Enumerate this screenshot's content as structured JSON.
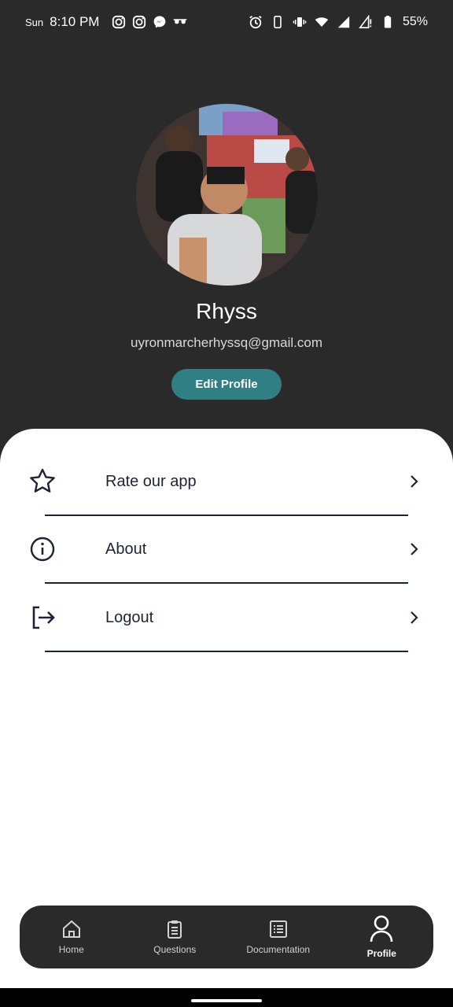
{
  "status_bar": {
    "day": "Sun",
    "time": "8:10 PM",
    "battery": "55%"
  },
  "profile": {
    "name": "Rhyss",
    "email": "uyronmarcherhyssq@gmail.com",
    "edit_label": "Edit Profile",
    "accent_color": "#2f7f84"
  },
  "menu": {
    "items": [
      {
        "label": "Rate our app",
        "icon": "star-icon"
      },
      {
        "label": "About",
        "icon": "info-icon"
      },
      {
        "label": "Logout",
        "icon": "logout-icon"
      }
    ]
  },
  "nav": {
    "items": [
      {
        "label": "Home",
        "icon": "home-icon"
      },
      {
        "label": "Questions",
        "icon": "clipboard-icon"
      },
      {
        "label": "Documentation",
        "icon": "document-list-icon"
      },
      {
        "label": "Profile",
        "icon": "person-icon",
        "active": true
      }
    ]
  }
}
